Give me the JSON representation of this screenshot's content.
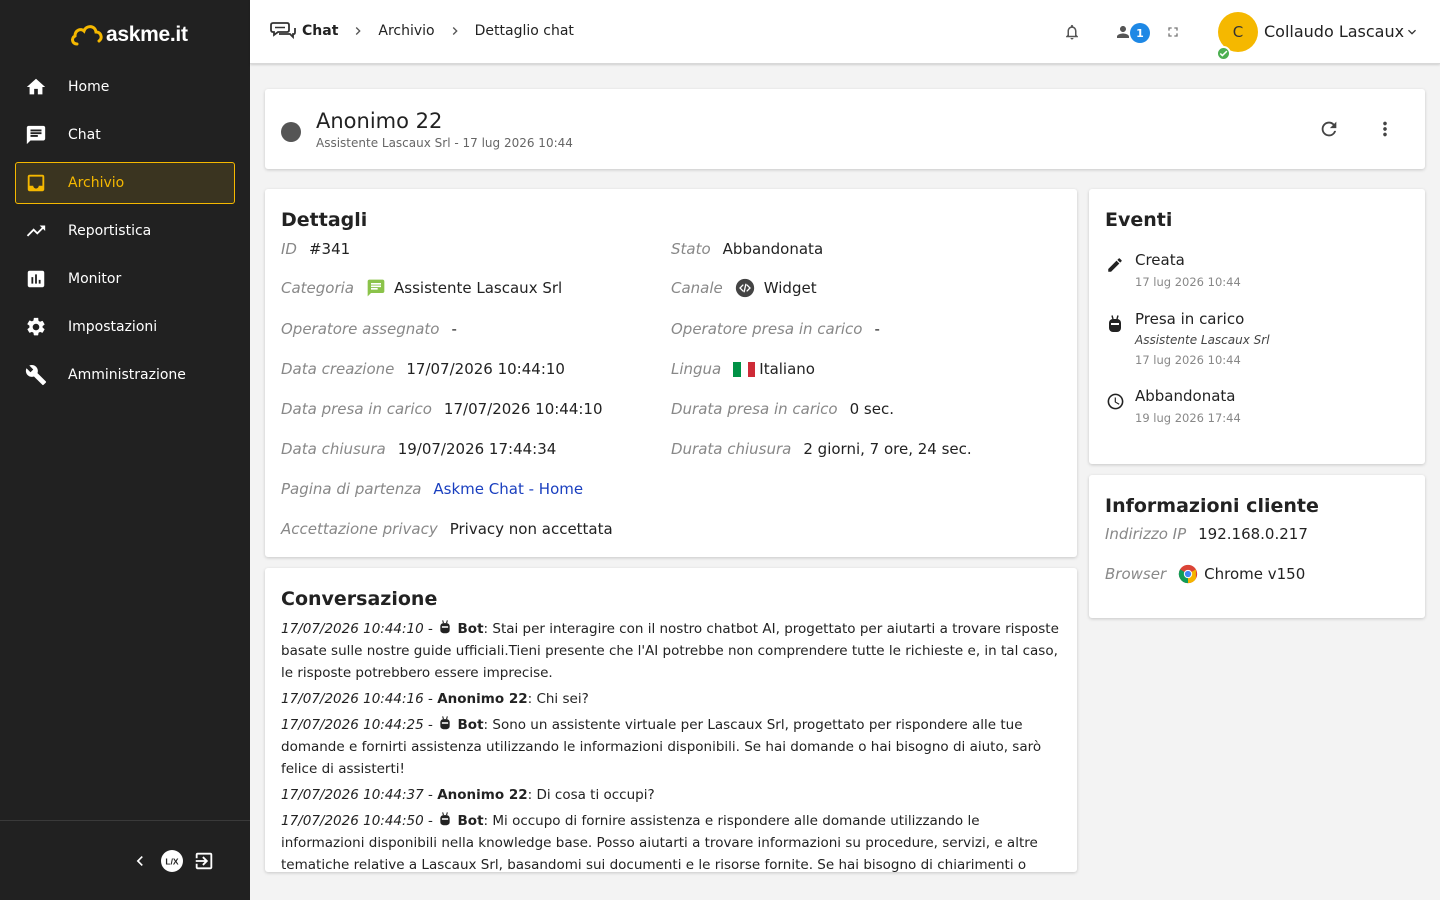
{
  "brand": {
    "name": "askme.it",
    "accent": "#f5b800"
  },
  "sidebar": {
    "items": [
      {
        "label": "Home",
        "icon": "home-icon"
      },
      {
        "label": "Chat",
        "icon": "chat-icon"
      },
      {
        "label": "Archivio",
        "icon": "inbox-icon",
        "active": true
      },
      {
        "label": "Reportistica",
        "icon": "trending-up-icon"
      },
      {
        "label": "Monitor",
        "icon": "bar-chart-icon"
      },
      {
        "label": "Impostazioni",
        "icon": "gear-icon"
      },
      {
        "label": "Amministrazione",
        "icon": "wrench-icon"
      }
    ]
  },
  "header": {
    "breadcrumb": [
      "Chat",
      "Archivio",
      "Dettaglio chat"
    ],
    "notifications_badge": "1",
    "user": {
      "initial": "C",
      "name": "Collaudo Lascaux"
    }
  },
  "chat": {
    "name": "Anonimo 22",
    "subtitle": "Assistente Lascaux Srl - 17 lug 2026 10:44"
  },
  "details": {
    "title": "Dettagli",
    "id": {
      "label": "ID",
      "value": "#341"
    },
    "stato": {
      "label": "Stato",
      "value": "Abbandonata"
    },
    "categoria": {
      "label": "Categoria",
      "value": "Assistente Lascaux Srl"
    },
    "canale": {
      "label": "Canale",
      "value": "Widget"
    },
    "operatore_assegnato": {
      "label": "Operatore assegnato",
      "value": "-"
    },
    "operatore_presa": {
      "label": "Operatore presa in carico",
      "value": "-"
    },
    "data_creazione": {
      "label": "Data creazione",
      "value": "17/07/2026 10:44:10"
    },
    "lingua": {
      "label": "Lingua",
      "value": "Italiano"
    },
    "data_presa": {
      "label": "Data presa in carico",
      "value": "17/07/2026 10:44:10"
    },
    "durata_presa": {
      "label": "Durata presa in carico",
      "value": "0 sec."
    },
    "data_chiusura": {
      "label": "Data chiusura",
      "value": "19/07/2026 17:44:34"
    },
    "durata_chiusura": {
      "label": "Durata chiusura",
      "value": "2 giorni, 7 ore, 24 sec."
    },
    "pagina": {
      "label": "Pagina di partenza",
      "value": "Askme Chat - Home"
    },
    "privacy": {
      "label": "Accettazione privacy",
      "value": "Privacy non accettata"
    }
  },
  "conversation": {
    "title": "Conversazione",
    "messages": [
      {
        "time": "17/07/2026 10:44:10",
        "sender": "Bot",
        "bot": true,
        "text": "Stai per interagire con il nostro chatbot AI, progettato per aiutarti a trovare risposte basate sulle nostre guide ufficiali.Tieni presente che l'AI potrebbe non comprendere tutte le richieste e, in tal caso, le risposte potrebbero essere imprecise."
      },
      {
        "time": "17/07/2026 10:44:16",
        "sender": "Anonimo 22",
        "bot": false,
        "text": "Chi sei?"
      },
      {
        "time": "17/07/2026 10:44:25",
        "sender": "Bot",
        "bot": true,
        "text": "Sono un assistente virtuale per Lascaux Srl, progettato per rispondere alle tue domande e fornirti assistenza utilizzando le informazioni disponibili. Se hai domande o hai bisogno di aiuto, sarò felice di assisterti!"
      },
      {
        "time": "17/07/2026 10:44:37",
        "sender": "Anonimo 22",
        "bot": false,
        "text": "Di cosa ti occupi?"
      },
      {
        "time": "17/07/2026 10:44:50",
        "sender": "Bot",
        "bot": true,
        "text": "Mi occupo di fornire assistenza e rispondere alle domande utilizzando le informazioni disponibili nella knowledge base. Posso aiutarti a trovare informazioni su procedure, servizi, e altre tematiche relative a Lascaux Srl, basandomi sui documenti e le risorse fornite. Se hai bisogno di chiarimenti o dettagli su un argomento"
      }
    ]
  },
  "events": {
    "title": "Eventi",
    "items": [
      {
        "label": "Creata",
        "date": "17 lug 2026 10:44",
        "icon": "pencil-icon"
      },
      {
        "label": "Presa in carico",
        "sub": "Assistente Lascaux Srl",
        "date": "17 lug 2026 10:44",
        "icon": "bot-icon"
      },
      {
        "label": "Abbandonata",
        "date": "19 lug 2026 17:44",
        "icon": "clock-icon"
      }
    ]
  },
  "client_info": {
    "title": "Informazioni cliente",
    "ip": {
      "label": "Indirizzo IP",
      "value": "192.168.0.217"
    },
    "browser": {
      "label": "Browser",
      "value": "Chrome v150"
    }
  }
}
